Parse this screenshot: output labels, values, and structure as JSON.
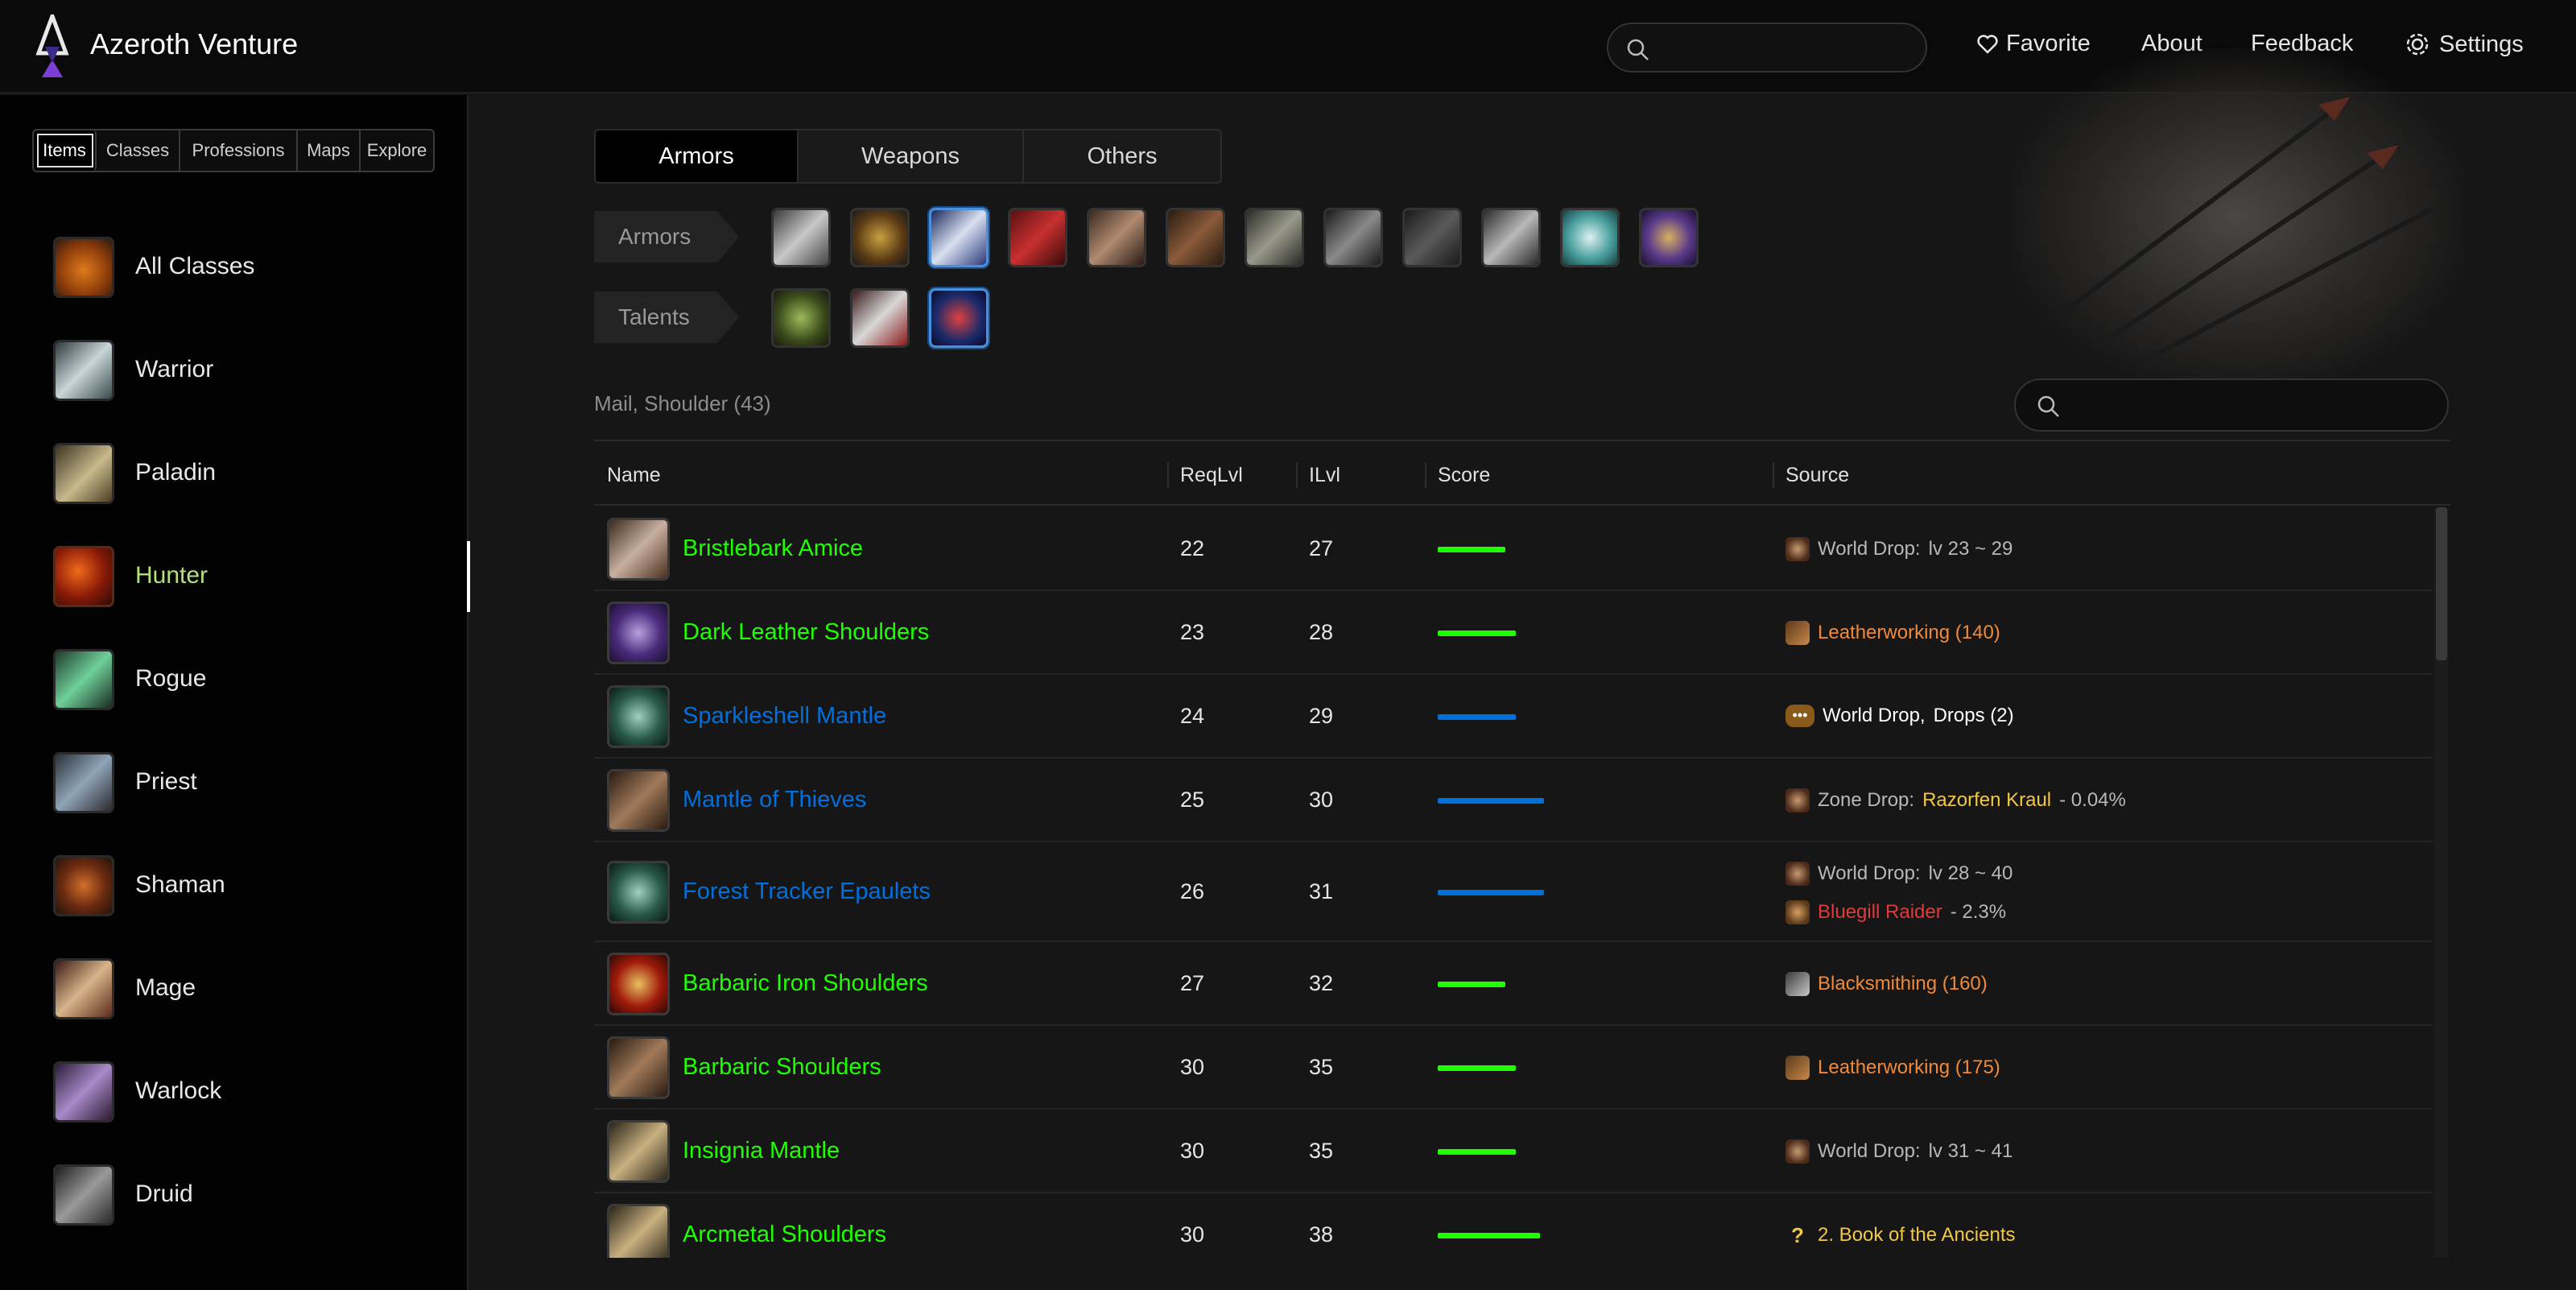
{
  "app": {
    "title": "Azeroth Venture"
  },
  "nav": {
    "search_placeholder": "",
    "favorite": "Favorite",
    "about": "About",
    "feedback": "Feedback",
    "settings": "Settings"
  },
  "sidebar": {
    "tabs": [
      "Items",
      "Classes",
      "Professions",
      "Maps",
      "Explore"
    ],
    "active_tab": "Items",
    "classes": [
      {
        "label": "All Classes",
        "icon": "pumpkin-icon"
      },
      {
        "label": "Warrior",
        "icon": "sword-icon"
      },
      {
        "label": "Paladin",
        "icon": "hammer-icon"
      },
      {
        "label": "Hunter",
        "icon": "bow-icon"
      },
      {
        "label": "Rogue",
        "icon": "dagger-icon"
      },
      {
        "label": "Priest",
        "icon": "staff-icon"
      },
      {
        "label": "Shaman",
        "icon": "totem-icon"
      },
      {
        "label": "Mage",
        "icon": "wand-icon"
      },
      {
        "label": "Warlock",
        "icon": "demon-icon"
      },
      {
        "label": "Druid",
        "icon": "claw-icon"
      }
    ],
    "active_class": "Hunter",
    "active_class_color": "#b2e07c"
  },
  "main": {
    "tabs": [
      "Armors",
      "Weapons",
      "Others"
    ],
    "active_tab": "Armors",
    "armors_label": "Armors",
    "talents_label": "Talents",
    "armor_slots": [
      "helmet-icon",
      "necklace-icon",
      "shoulder-icon",
      "cloak-icon",
      "chest-icon",
      "bracer-icon",
      "gloves-icon",
      "belt-icon",
      "legs-icon",
      "boots-icon",
      "ring-icon",
      "trinket-icon"
    ],
    "armor_selected": "shoulder-icon",
    "talent_slots": [
      "beast-mastery-icon",
      "marksmanship-icon",
      "survival-icon"
    ],
    "talent_selected": "survival-icon",
    "list_title": "Mail, Shoulder (43)",
    "list_search_placeholder": ""
  },
  "table": {
    "headers": {
      "name": "Name",
      "req": "ReqLvl",
      "ilvl": "ILvl",
      "score": "Score",
      "source": "Source"
    },
    "rows": [
      {
        "name": "Bristlebark Amice",
        "quality_color": "#1eff00",
        "req": "22",
        "ilvl": "27",
        "score": 0.31,
        "score_color": "#1eff00",
        "icon": "shoulder-bark-icon",
        "sources": [
          {
            "icon": "world-drop-icon",
            "parts": [
              {
                "text": "World Drop:",
                "color": "#b8b8b8"
              },
              {
                "text": "lv 23 ~ 29",
                "color": "#b8b8b8"
              }
            ]
          }
        ]
      },
      {
        "name": "Dark Leather Shoulders",
        "quality_color": "#1eff00",
        "req": "23",
        "ilvl": "28",
        "score": 0.36,
        "score_color": "#1eff00",
        "icon": "shoulder-purple-icon",
        "sources": [
          {
            "icon": "leatherworking-icon",
            "parts": [
              {
                "text": "Leatherworking (140)",
                "color": "#ef8a3a"
              }
            ]
          }
        ]
      },
      {
        "name": "Sparkleshell Mantle",
        "quality_color": "#0070dd",
        "req": "24",
        "ilvl": "29",
        "score": 0.36,
        "score_color": "#0070dd",
        "icon": "shoulder-teal-icon",
        "sources": [
          {
            "icon": "more-icon",
            "parts": [
              {
                "text": "World Drop,",
                "color": "#ffffff"
              },
              {
                "text": "Drops (2)",
                "color": "#ffffff"
              }
            ]
          }
        ]
      },
      {
        "name": "Mantle of Thieves",
        "quality_color": "#0070dd",
        "req": "25",
        "ilvl": "30",
        "score": 0.49,
        "score_color": "#0070dd",
        "icon": "shoulder-brown-icon",
        "sources": [
          {
            "icon": "world-drop-icon",
            "parts": [
              {
                "text": "Zone Drop:",
                "color": "#b8b8b8"
              },
              {
                "text": "Razorfen Kraul",
                "color": "#f2c744"
              },
              {
                "text": "- 0.04%",
                "color": "#b8b8b8"
              }
            ]
          }
        ]
      },
      {
        "name": "Forest Tracker Epaulets",
        "quality_color": "#0070dd",
        "req": "26",
        "ilvl": "31",
        "score": 0.49,
        "score_color": "#0070dd",
        "icon": "shoulder-teal-icon",
        "sources": [
          {
            "icon": "world-drop-icon",
            "parts": [
              {
                "text": "World Drop:",
                "color": "#b8b8b8"
              },
              {
                "text": "lv 28 ~ 40",
                "color": "#b8b8b8"
              }
            ]
          },
          {
            "icon": "loot-bag-icon",
            "parts": [
              {
                "text": "Bluegill Raider",
                "color": "#e03a3a"
              },
              {
                "text": "- 2.3%",
                "color": "#b8b8b8"
              }
            ]
          }
        ]
      },
      {
        "name": "Barbaric Iron Shoulders",
        "quality_color": "#1eff00",
        "req": "27",
        "ilvl": "32",
        "score": 0.31,
        "score_color": "#1eff00",
        "icon": "shoulder-red-icon",
        "sources": [
          {
            "icon": "blacksmithing-icon",
            "parts": [
              {
                "text": "Blacksmithing (160)",
                "color": "#ef8a3a"
              }
            ]
          }
        ]
      },
      {
        "name": "Barbaric Shoulders",
        "quality_color": "#1eff00",
        "req": "30",
        "ilvl": "35",
        "score": 0.36,
        "score_color": "#1eff00",
        "icon": "shoulder-brown-icon",
        "sources": [
          {
            "icon": "leatherworking-icon",
            "parts": [
              {
                "text": "Leatherworking (175)",
                "color": "#ef8a3a"
              }
            ]
          }
        ]
      },
      {
        "name": "Insignia Mantle",
        "quality_color": "#1eff00",
        "req": "30",
        "ilvl": "35",
        "score": 0.36,
        "score_color": "#1eff00",
        "icon": "shoulder-insignia-icon",
        "sources": [
          {
            "icon": "world-drop-icon",
            "parts": [
              {
                "text": "World Drop:",
                "color": "#b8b8b8"
              },
              {
                "text": "lv 31 ~ 41",
                "color": "#b8b8b8"
              }
            ]
          }
        ]
      },
      {
        "name": "Arcmetal Shoulders",
        "quality_color": "#1eff00",
        "req": "30",
        "ilvl": "38",
        "score": 0.47,
        "score_color": "#1eff00",
        "icon": "shoulder-insignia-icon",
        "sources": [
          {
            "icon": "quest-icon",
            "parts": [
              {
                "text": "2. Book of the Ancients",
                "color": "#f2c744"
              }
            ]
          }
        ]
      }
    ]
  }
}
